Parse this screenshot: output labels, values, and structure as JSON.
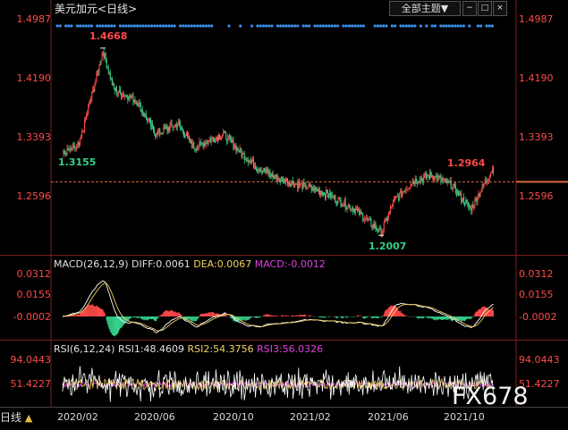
{
  "header": {
    "title": "美元加元",
    "period": "<日线>",
    "theme_button": "全部主题",
    "theme_arrow": "▼"
  },
  "price_axis": {
    "left": [
      "1.4987",
      "1.4190",
      "1.3393",
      "1.2596"
    ],
    "right": [
      "1.4987",
      "1.4190",
      "1.3393",
      "1.2596"
    ]
  },
  "annotations": {
    "high": "1.4668",
    "start_low": "1.3155",
    "recent_high": "1.2964",
    "low": "1.2007"
  },
  "macd": {
    "title": "MACD(26,12,9)",
    "diff": "DIFF:0.0061",
    "dea": "DEA:0.0067",
    "macd": "MACD:-0.0012",
    "axis_left": [
      "0.0312",
      "0.0155",
      "-0.0002"
    ],
    "axis_right": [
      "0.0312",
      "0.0155",
      "-0.0002"
    ]
  },
  "rsi": {
    "title": "RSI(6,12,24)",
    "rsi1": "RSI1:48.4609",
    "rsi2": "RSI2:54.3756",
    "rsi3": "RSI3:56.0326",
    "axis_left": [
      "94.0443",
      "51.4227"
    ],
    "axis_right": [
      "94.0443",
      "51.4227"
    ]
  },
  "x_axis": [
    "2020/02",
    "2020/06",
    "2020/10",
    "2021/02",
    "2021/06",
    "2021/10"
  ],
  "footer": {
    "period_label": "日线",
    "arrow": "▲"
  },
  "watermark": "FX678",
  "colors": {
    "up": "#ff4a4a",
    "down": "#35d08a",
    "dots": "#3a8ee8",
    "dea": "#f0d060"
  },
  "chart_data": {
    "type": "candlestick",
    "x_range": [
      "2020/01",
      "2021/11"
    ],
    "ylim": [
      1.18,
      1.515
    ],
    "reference_price": 1.275,
    "anchors": [
      {
        "date": "2020-01-15",
        "price": 1.3155
      },
      {
        "date": "2020-02-10",
        "price": 1.328
      },
      {
        "date": "2020-03-19",
        "price": 1.4668
      },
      {
        "date": "2020-04-05",
        "price": 1.41
      },
      {
        "date": "2020-05-10",
        "price": 1.395
      },
      {
        "date": "2020-06-10",
        "price": 1.345
      },
      {
        "date": "2020-07-15",
        "price": 1.36
      },
      {
        "date": "2020-08-10",
        "price": 1.325
      },
      {
        "date": "2020-09-25",
        "price": 1.345
      },
      {
        "date": "2020-10-25",
        "price": 1.315
      },
      {
        "date": "2020-11-20",
        "price": 1.295
      },
      {
        "date": "2020-12-20",
        "price": 1.28
      },
      {
        "date": "2021-01-25",
        "price": 1.27
      },
      {
        "date": "2021-03-01",
        "price": 1.26
      },
      {
        "date": "2021-04-20",
        "price": 1.235
      },
      {
        "date": "2021-06-01",
        "price": 1.2007
      },
      {
        "date": "2021-06-20",
        "price": 1.245
      },
      {
        "date": "2021-07-20",
        "price": 1.275
      },
      {
        "date": "2021-08-20",
        "price": 1.285
      },
      {
        "date": "2021-09-20",
        "price": 1.27
      },
      {
        "date": "2021-10-20",
        "price": 1.235
      },
      {
        "date": "2021-11-25",
        "price": 1.2964
      }
    ]
  }
}
